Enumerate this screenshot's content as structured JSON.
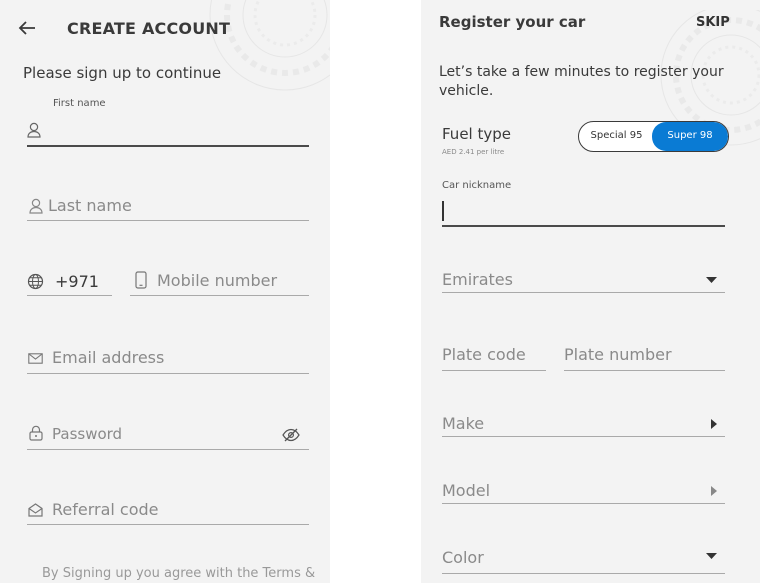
{
  "create_account": {
    "back_icon": "arrow-left-icon",
    "title": "CREATE ACCOUNT",
    "subtitle": "Please sign up to continue",
    "first_name": {
      "label": "First name",
      "icon": "person-icon",
      "value": ""
    },
    "last_name": {
      "placeholder": "Last name",
      "icon": "person-icon"
    },
    "phone": {
      "country_icon": "globe-icon",
      "country_code": "+971",
      "mobile_icon": "mobile-phone-icon",
      "mobile_placeholder": "Mobile number"
    },
    "email": {
      "placeholder": "Email address",
      "icon": "envelope-icon"
    },
    "password": {
      "placeholder": "Password",
      "icon": "lock-icon",
      "toggle_icon": "eye-off-icon"
    },
    "referral": {
      "placeholder": "Referral code",
      "icon": "referral-icon"
    },
    "terms_text": "By Signing up you agree with the Terms &"
  },
  "register_car": {
    "title": "Register your car",
    "skip_label": "SKIP",
    "intro": "Let’s take a few minutes to register your vehicle.",
    "fuel": {
      "label": "Fuel type",
      "price": "AED 2.41 per litre",
      "options": [
        "Special 95",
        "Super 98"
      ],
      "selected": "Super 98",
      "selected_color": "#0a7bd4"
    },
    "car_nickname": {
      "label": "Car nickname",
      "value": ""
    },
    "emirates": {
      "placeholder": "Emirates",
      "icon": "caret-down-icon"
    },
    "plate_code": {
      "placeholder": "Plate code"
    },
    "plate_number": {
      "placeholder": "Plate number"
    },
    "make": {
      "placeholder": "Make",
      "icon": "caret-right-icon"
    },
    "model": {
      "placeholder": "Model",
      "icon": "caret-right-icon"
    },
    "color": {
      "placeholder": "Color",
      "icon": "caret-down-icon"
    }
  }
}
